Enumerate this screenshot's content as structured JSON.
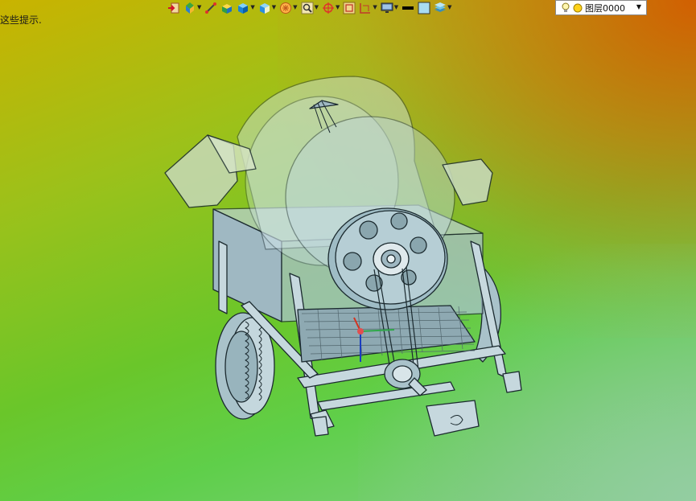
{
  "hint": {
    "text": "这些提示."
  },
  "toolbar": {
    "buttons": [
      {
        "icon": "exit-sketch-icon",
        "has_dropdown": false
      },
      {
        "icon": "view-orientation-icon",
        "has_dropdown": true
      },
      {
        "icon": "draw-line-icon",
        "has_dropdown": false
      },
      {
        "icon": "shaded-box-icon",
        "has_dropdown": false
      },
      {
        "icon": "display-style-icon",
        "has_dropdown": true
      },
      {
        "icon": "section-view-icon",
        "has_dropdown": true
      },
      {
        "icon": "hide-show-icon",
        "has_dropdown": true
      },
      {
        "icon": "zoom-icon",
        "has_dropdown": true
      },
      {
        "icon": "rotate-axis-icon",
        "has_dropdown": true
      },
      {
        "icon": "zoom-window-icon",
        "has_dropdown": false
      },
      {
        "icon": "dimension-icon",
        "has_dropdown": true
      },
      {
        "icon": "monitor-icon",
        "has_dropdown": true
      },
      {
        "icon": "line-weight-icon",
        "has_dropdown": false
      },
      {
        "icon": "color-swatch-icon",
        "has_dropdown": false
      },
      {
        "icon": "layers-icon",
        "has_dropdown": true
      }
    ]
  },
  "layer_selector": {
    "value": "图层0000"
  },
  "colors": {
    "bg_top_left": "#c9b300",
    "bg_top_right": "#d55a00",
    "bg_bottom_left": "#5fcf4a",
    "bg_bottom_right": "#86cf8e",
    "model_line": "#1b2a2f",
    "model_fill": "#a9c6d0"
  }
}
